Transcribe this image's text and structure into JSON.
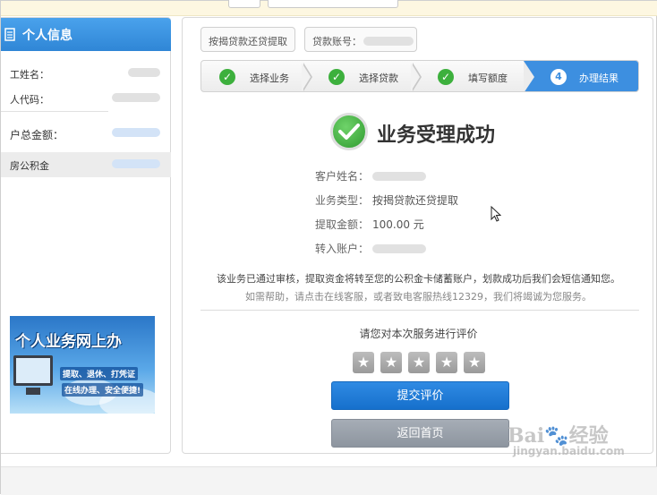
{
  "left_panel": {
    "title": "个人信息",
    "rows": [
      {
        "label": "工姓名："
      },
      {
        "label": "人代码："
      },
      {
        "label": "户总金额："
      },
      {
        "label": "房公积金"
      }
    ],
    "banner": {
      "title": "个人业务网上办",
      "line1": "提取、退休、打凭证",
      "line2": "在线办理、安全便捷!"
    }
  },
  "tabs": [
    {
      "label": "按揭贷款还贷提取"
    },
    {
      "label": "贷款账号："
    }
  ],
  "steps": [
    {
      "label": "选择业务",
      "state": "done"
    },
    {
      "label": "选择贷款",
      "state": "done"
    },
    {
      "label": "填写额度",
      "state": "done"
    },
    {
      "number": "4",
      "label": "办理结果",
      "state": "active"
    }
  ],
  "result": {
    "title": "业务受理成功",
    "fields": [
      {
        "key": "客户姓名：",
        "value": ""
      },
      {
        "key": "业务类型：",
        "value": "按揭贷款还贷提取"
      },
      {
        "key": "提取金额：",
        "value": "100.00 元"
      },
      {
        "key": "转入账户：",
        "value": ""
      }
    ],
    "note_main": "该业务已通过审核，提取资金将转至您的公积金卡储蓄账户，划款成功后我们会短信通知您。",
    "note_help": "如需帮助，请点击在线客服，或者致电客服热线12329，我们将竭诚为您服务。"
  },
  "rating": {
    "prompt": "请您对本次服务进行评价",
    "stars": 5,
    "star_glyph": "★",
    "submit_label": "提交评价",
    "back_label": "返回首页"
  },
  "watermark": {
    "brand": "Bai",
    "brand2": "经验",
    "url": "jingyan.baidu.com"
  },
  "colors": {
    "accent": "#3d8fe0",
    "success": "#3db03d",
    "header_blue": "#2f86d6"
  }
}
